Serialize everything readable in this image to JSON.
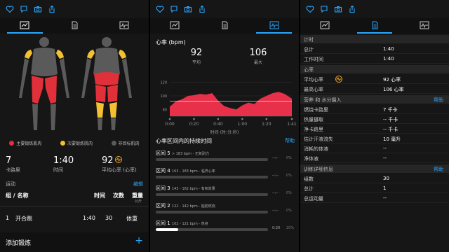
{
  "accent": "#2aa7ff",
  "screen1": {
    "legend": {
      "primary": "主要锻炼肌肉",
      "secondary": "次要锻炼肌肉",
      "nontarget": "非目标肌肉",
      "primary_color": "#e0303a",
      "secondary_color": "#f2c030",
      "nontarget_color": "#5a5a5a"
    },
    "calories": {
      "value": "7",
      "label": "卡路里"
    },
    "time": {
      "value": "1:40",
      "label": "时间"
    },
    "heart": {
      "value": "92",
      "label": "平均心率 (心率)"
    },
    "activity_label": "运动",
    "edit_label": "编辑",
    "table_headers": {
      "name": "组 / 名称",
      "time": "时间",
      "reps": "次数",
      "weight": "重量",
      "weight_unit": "公斤"
    },
    "rows": [
      {
        "index": "1",
        "name": "开合跳",
        "time": "1:40",
        "reps": "30",
        "weight": "体重"
      }
    ],
    "add_label": "添加锻炼",
    "add_icon": "+"
  },
  "screen2": {
    "title": "心率 (bpm)",
    "avg": {
      "value": "92",
      "label": "平均"
    },
    "max": {
      "value": "106",
      "label": "最大"
    },
    "y_ticks": [
      "120",
      "100",
      "80"
    ],
    "x_ticks": [
      "0:00",
      "0:20",
      "0:40",
      "1:00",
      "1:20",
      "1:41"
    ],
    "x_axis_label": "时间 (时:分:秒)",
    "zones_title": "心率区间内的持续时间",
    "help_label": "帮助",
    "zones": [
      {
        "name": "区间 5",
        "desc": "> 183 bpm - 无氧耐力",
        "time": "--:--",
        "pct": "0%",
        "fill": 0
      },
      {
        "name": "区间 4",
        "desc": "163 - 183 bpm - 临界心率",
        "time": "--:--",
        "pct": "0%",
        "fill": 0
      },
      {
        "name": "区间 3",
        "desc": "143 - 162 bpm - 有氧效果",
        "time": "--:--",
        "pct": "0%",
        "fill": 0
      },
      {
        "name": "区间 2",
        "desc": "122 - 142 bpm - 脂肪燃烧",
        "time": "--:--",
        "pct": "0%",
        "fill": 0
      },
      {
        "name": "区间 1",
        "desc": "102 - 121 bpm - 热身",
        "time": "0:20",
        "pct": "20%",
        "fill": 0.2
      }
    ],
    "chart_data": {
      "type": "area",
      "x": [
        0,
        5,
        10,
        15,
        20,
        25,
        30,
        35,
        40,
        45,
        50,
        55,
        60,
        65,
        70,
        75,
        80,
        85,
        90,
        95,
        101
      ],
      "y": [
        84,
        92,
        95,
        100,
        101,
        103,
        102,
        104,
        93,
        85,
        82,
        80,
        86,
        90,
        88,
        96,
        100,
        104,
        106,
        103,
        96
      ],
      "ylim": [
        70,
        130
      ],
      "xlabel": "时间 (时:分:秒)",
      "ylabel": "心率 (bpm)",
      "avg_line": 92,
      "color": "#e8304a"
    }
  },
  "screen3": {
    "sections": [
      {
        "title": "计时",
        "help": "",
        "items": [
          {
            "k": "总计",
            "v": "1:40"
          },
          {
            "k": "工作时间",
            "v": "1:40"
          }
        ]
      },
      {
        "title": "心率",
        "help": "",
        "items": [
          {
            "k": "平均心率",
            "v": "92 心率"
          },
          {
            "k": "最高心率",
            "v": "106 心率"
          }
        ]
      },
      {
        "title": "营养 和 水分摄入",
        "help": "帮助",
        "items": [
          {
            "k": "燃烧卡路里",
            "v": "7 千卡"
          },
          {
            "k": "热量摄取",
            "v": "-- 千卡"
          },
          {
            "k": "净卡路里",
            "v": "-- 千卡"
          },
          {
            "k": "估计汗液流失",
            "v": "10 毫升"
          },
          {
            "k": "消耗的体液",
            "v": "--"
          },
          {
            "k": "净体液",
            "v": "--"
          }
        ]
      },
      {
        "title": "训练详细信息",
        "help": "帮助",
        "items": [
          {
            "k": "组数",
            "v": "30"
          },
          {
            "k": "总计",
            "v": "1"
          },
          {
            "k": "总运动量",
            "v": "--"
          }
        ]
      }
    ]
  }
}
